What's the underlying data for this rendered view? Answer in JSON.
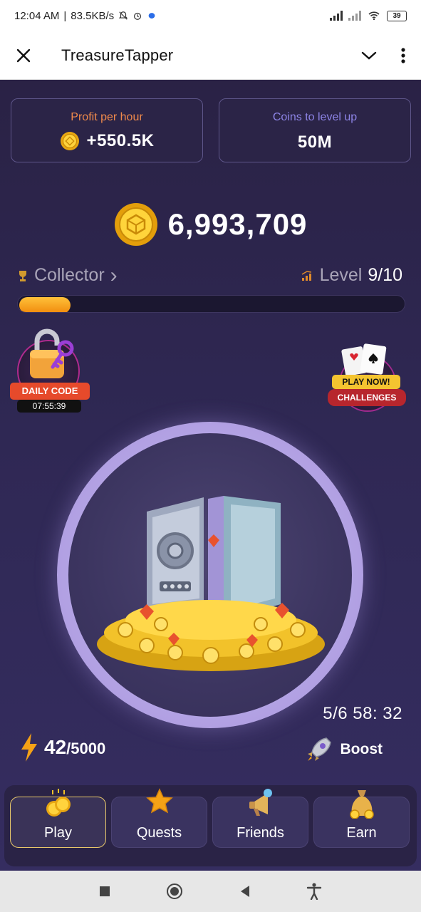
{
  "status_bar": {
    "time": "12:04 AM",
    "speed": "83.5KB/s",
    "battery": "39"
  },
  "app_bar": {
    "title": "TreasureTapper"
  },
  "stats": {
    "profit_label": "Profit per hour",
    "profit_value": "+550.5K",
    "level_label": "Coins to level up",
    "level_value": "50M"
  },
  "balance": "6,993,709",
  "rank": {
    "name": "Collector",
    "chevron": "›"
  },
  "level": {
    "label": "Level",
    "value": "9/10",
    "progress": 0.14
  },
  "daily_code": {
    "label": "DAILY CODE",
    "countdown": "07:55:39"
  },
  "challenges": {
    "badge": "PLAY NOW!",
    "label": "CHALLENGES"
  },
  "boost_timer": "5/6  58: 32",
  "energy": {
    "current": "42",
    "max": "/5000"
  },
  "boost_label": "Boost",
  "nav": {
    "items": [
      {
        "label": "Play",
        "icon": "coins-icon"
      },
      {
        "label": "Quests",
        "icon": "star-icon"
      },
      {
        "label": "Friends",
        "icon": "megaphone-icon"
      },
      {
        "label": "Earn",
        "icon": "money-bag-icon"
      }
    ]
  },
  "colors": {
    "profit_label": "#f08a4b",
    "level_label": "#8d84e6",
    "accent_orange": "#f5a216",
    "background": "#2f2854",
    "daily_ribbon": "#e64a2b",
    "challenge_ribbon": "#b7262d",
    "challenge_badge": "#f4c430"
  }
}
